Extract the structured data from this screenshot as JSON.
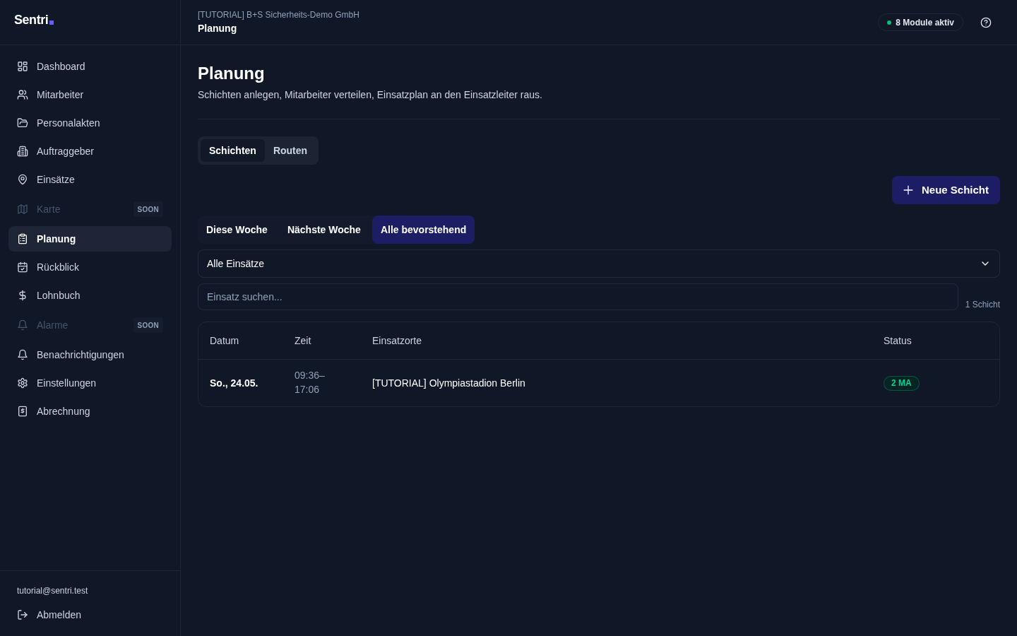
{
  "sidebar": {
    "logo": "Sentri",
    "nav_items": [
      {
        "label": "Dashboard",
        "selected": false,
        "disabled": false
      },
      {
        "label": "Mitarbeiter",
        "selected": false,
        "disabled": false
      },
      {
        "label": "Personalakten",
        "selected": false,
        "disabled": false
      },
      {
        "label": "Auftraggeber",
        "selected": false,
        "disabled": false
      },
      {
        "label": "Einsätze",
        "selected": false,
        "disabled": false
      },
      {
        "label": "Karte",
        "selected": false,
        "disabled": true,
        "badge": "SOON"
      },
      {
        "label": "Planung",
        "selected": true,
        "disabled": false
      },
      {
        "label": "Rückblick",
        "selected": false,
        "disabled": false
      },
      {
        "label": "Lohnbuch",
        "selected": false,
        "disabled": false
      },
      {
        "label": "Alarme",
        "selected": false,
        "disabled": true,
        "badge": "SOON"
      },
      {
        "label": "Benachrichtigungen",
        "selected": false,
        "disabled": false
      },
      {
        "label": "Einstellungen",
        "selected": false,
        "disabled": false
      },
      {
        "label": "Abrechnung",
        "selected": false,
        "disabled": false
      }
    ],
    "user_email": "tutorial@sentri.test",
    "logout": "Abmelden"
  },
  "header": {
    "organization": "[TUTORIAL] B+S Sicherheits-Demo GmbH",
    "page": "Planung",
    "modules_badge": "8 Module aktiv"
  },
  "page": {
    "title": "Planung",
    "subtitle": "Schichten anlegen, Mitarbeiter verteilen, Einsatzplan an den Einsatzleiter raus."
  },
  "view_tabs": [
    {
      "label": "Schichten",
      "selected": true
    },
    {
      "label": "Routen",
      "selected": false
    }
  ],
  "new_button": "Neue Schicht",
  "period_tabs": [
    {
      "label": "Diese Woche",
      "selected": false
    },
    {
      "label": "Nächste Woche",
      "selected": false
    },
    {
      "label": "Alle bevorstehend",
      "selected": true
    }
  ],
  "filter_select": {
    "value": "Alle Einsätze"
  },
  "search": {
    "placeholder": "Einsatz suchen..."
  },
  "result_count": "1 Schicht",
  "table": {
    "columns": [
      "Datum",
      "Zeit",
      "Einsatzorte",
      "Status"
    ],
    "rows": [
      {
        "date": "So., 24.05.",
        "time": "09:36–17:06",
        "location": "[TUTORIAL] Olympiastadion Berlin",
        "status": "2 MA"
      }
    ]
  }
}
